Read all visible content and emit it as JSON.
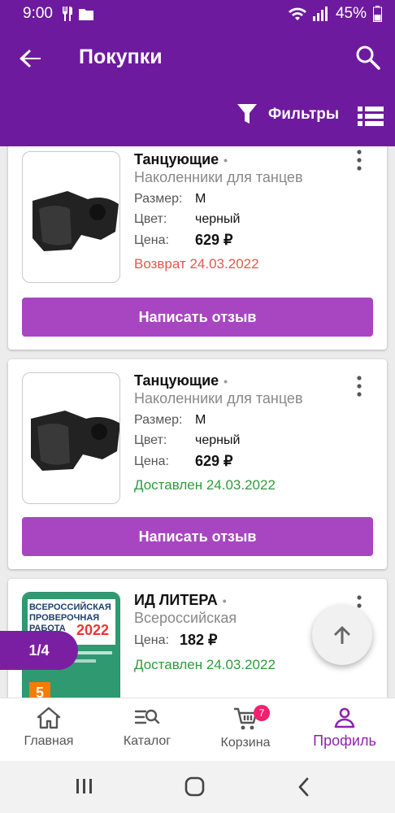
{
  "status_bar": {
    "time": "9:00",
    "battery": "45%"
  },
  "app_bar": {
    "title": "Покупки",
    "filters_label": "Фильтры"
  },
  "orders": [
    {
      "brand": "Танцующие",
      "product": "Наколенники для танцев",
      "size_label": "Размер:",
      "size": "M",
      "color_label": "Цвет:",
      "color": "черный",
      "price_label": "Цена:",
      "price": "629 ₽",
      "status": "Возврат 24.03.2022",
      "review_button": "Написать отзыв"
    },
    {
      "brand": "Танцующие",
      "product": "Наколенники для танцев",
      "size_label": "Размер:",
      "size": "M",
      "color_label": "Цвет:",
      "color": "черный",
      "price_label": "Цена:",
      "price": "629 ₽",
      "status": "Доставлен 24.03.2022",
      "review_button": "Написать отзыв"
    },
    {
      "brand": "ИД ЛИТЕРА",
      "product": "Всероссийская",
      "price_label": "Цена:",
      "price": "182 ₽",
      "status": "Доставлен 24.03.2022",
      "cover_line1": "ВСЕРОССИЙСКАЯ",
      "cover_line2": "ПРОВЕРОЧНАЯ",
      "cover_line3": "РАБОТА",
      "cover_year": "2022",
      "cover_grade": "5"
    }
  ],
  "pagination": {
    "label": "1/4"
  },
  "bottom_nav": {
    "home": "Главная",
    "catalog": "Каталог",
    "cart": "Корзина",
    "cart_badge": "7",
    "profile": "Профиль"
  },
  "colors": {
    "app_bar": "#6e1a9e",
    "button": "#a846c2",
    "returned": "#e6564e",
    "delivered": "#2e9b3c",
    "active_nav": "#8e24aa"
  }
}
